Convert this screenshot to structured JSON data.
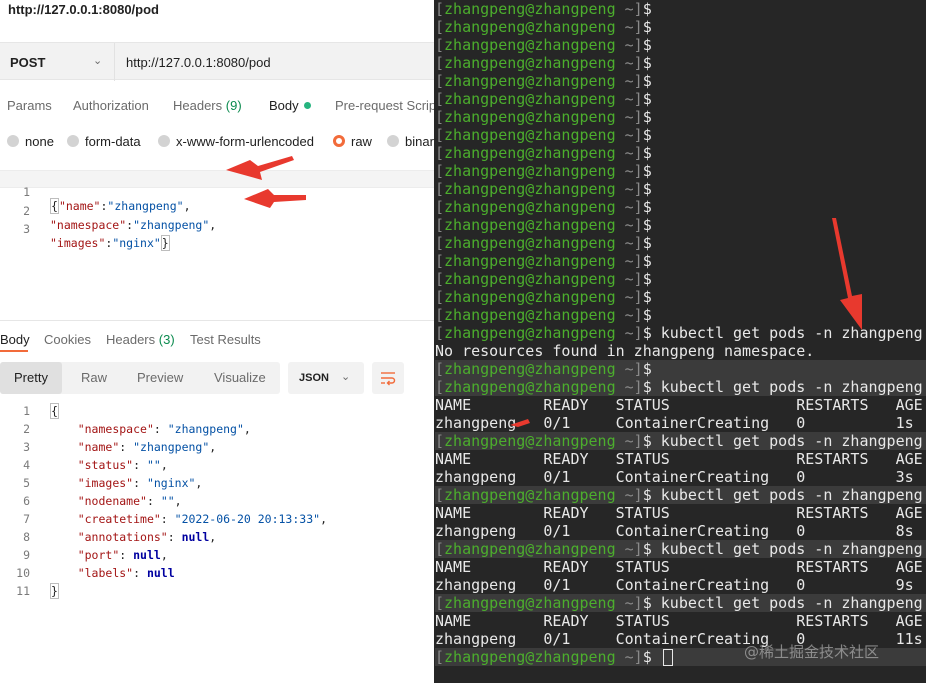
{
  "window": {
    "title": "http://127.0.0.1:8080/pod"
  },
  "request": {
    "method": "POST",
    "url": "http://127.0.0.1:8080/pod"
  },
  "request_tabs": {
    "params": "Params",
    "authorization": "Authorization",
    "headers": "Headers",
    "headers_count": "(9)",
    "body": "Body",
    "prerequest": "Pre-request Scrip"
  },
  "body_types": [
    "none",
    "form-data",
    "x-www-form-urlencoded",
    "raw",
    "binar"
  ],
  "request_body": {
    "line_numbers": [
      "1",
      "2",
      "3"
    ],
    "brace_open": "{",
    "brace_close": "}",
    "name_key": "\"name\"",
    "name_val": "\"zhangpeng\"",
    "namespace_key": "\"namespace\"",
    "namespace_val": "\"zhangpeng\"",
    "images_key": "\"images\"",
    "images_val": "\"nginx\""
  },
  "response_tabs": {
    "body": "Body",
    "cookies": "Cookies",
    "headers": "Headers",
    "headers_count": "(3)",
    "test_results": "Test Results"
  },
  "view_modes": [
    "Pretty",
    "Raw",
    "Preview",
    "Visualize"
  ],
  "format": "JSON",
  "response_body": {
    "line_numbers": [
      "1",
      "2",
      "3",
      "4",
      "5",
      "6",
      "7",
      "8",
      "9",
      "10",
      "11"
    ],
    "open": "{",
    "close": "}",
    "fields": [
      {
        "key": "\"namespace\"",
        "value": "\"zhangpeng\"",
        "type": "string"
      },
      {
        "key": "\"name\"",
        "value": "\"zhangpeng\"",
        "type": "string"
      },
      {
        "key": "\"status\"",
        "value": "\"\"",
        "type": "string"
      },
      {
        "key": "\"images\"",
        "value": "\"nginx\"",
        "type": "string"
      },
      {
        "key": "\"nodename\"",
        "value": "\"\"",
        "type": "string"
      },
      {
        "key": "\"createtime\"",
        "value": "\"2022-06-20 20:13:33\"",
        "type": "string"
      },
      {
        "key": "\"annotations\"",
        "value": "null",
        "type": "null"
      },
      {
        "key": "\"port\"",
        "value": "null",
        "type": "null"
      },
      {
        "key": "\"labels\"",
        "value": "null",
        "type": "null"
      }
    ]
  },
  "terminal": {
    "prompt": {
      "open": "[",
      "user": "zhangpeng@zhangpeng",
      "dir": " ~]",
      "symbol": "$"
    },
    "lines": [
      {
        "kind": "prompt",
        "cmd": ""
      },
      {
        "kind": "prompt",
        "cmd": ""
      },
      {
        "kind": "prompt",
        "cmd": ""
      },
      {
        "kind": "prompt",
        "cmd": ""
      },
      {
        "kind": "prompt",
        "cmd": ""
      },
      {
        "kind": "prompt",
        "cmd": ""
      },
      {
        "kind": "prompt",
        "cmd": ""
      },
      {
        "kind": "prompt",
        "cmd": ""
      },
      {
        "kind": "prompt",
        "cmd": ""
      },
      {
        "kind": "prompt",
        "cmd": ""
      },
      {
        "kind": "prompt",
        "cmd": ""
      },
      {
        "kind": "prompt",
        "cmd": ""
      },
      {
        "kind": "prompt",
        "cmd": ""
      },
      {
        "kind": "prompt",
        "cmd": ""
      },
      {
        "kind": "prompt",
        "cmd": ""
      },
      {
        "kind": "prompt",
        "cmd": ""
      },
      {
        "kind": "prompt",
        "cmd": ""
      },
      {
        "kind": "prompt",
        "cmd": ""
      },
      {
        "kind": "prompt",
        "cmd": " kubectl get pods -n zhangpeng"
      },
      {
        "kind": "output",
        "text": "No resources found in zhangpeng namespace."
      },
      {
        "kind": "prompt",
        "cmd": ""
      },
      {
        "kind": "prompt",
        "cmd": " kubectl get pods -n zhangpeng"
      },
      {
        "kind": "output",
        "text": "NAME        READY   STATUS              RESTARTS   AGE"
      },
      {
        "kind": "output",
        "text": "zhangpeng   0/1     ContainerCreating   0          1s"
      },
      {
        "kind": "prompt",
        "cmd": " kubectl get pods -n zhangpeng"
      },
      {
        "kind": "output",
        "text": "NAME        READY   STATUS              RESTARTS   AGE"
      },
      {
        "kind": "output",
        "text": "zhangpeng   0/1     ContainerCreating   0          3s"
      },
      {
        "kind": "prompt",
        "cmd": " kubectl get pods -n zhangpeng"
      },
      {
        "kind": "output",
        "text": "NAME        READY   STATUS              RESTARTS   AGE"
      },
      {
        "kind": "output",
        "text": "zhangpeng   0/1     ContainerCreating   0          8s"
      },
      {
        "kind": "prompt",
        "cmd": " kubectl get pods -n zhangpeng"
      },
      {
        "kind": "output",
        "text": "NAME        READY   STATUS              RESTARTS   AGE"
      },
      {
        "kind": "output",
        "text": "zhangpeng   0/1     ContainerCreating   0          9s"
      },
      {
        "kind": "prompt",
        "cmd": " kubectl get pods -n zhangpeng"
      },
      {
        "kind": "output",
        "text": "NAME        READY   STATUS              RESTARTS   AGE"
      },
      {
        "kind": "output",
        "text": "zhangpeng   0/1     ContainerCreating   0          11s"
      },
      {
        "kind": "prompt",
        "cmd": " ",
        "cursor": true
      }
    ],
    "watermark": "@稀土掘金技术社区"
  },
  "colors": {
    "accent": "#f26b3a",
    "active_dot": "#26b47f",
    "count_green": "#0c8b4f",
    "terminal_bg": "#262626",
    "prompt_green": "#4cae2d",
    "annotation_red": "#e8392e"
  }
}
